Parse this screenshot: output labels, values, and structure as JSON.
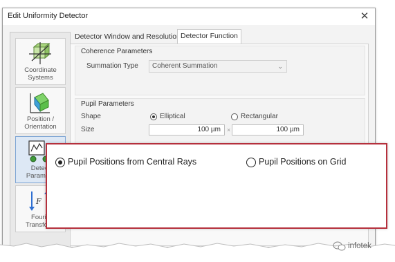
{
  "window": {
    "title": "Edit Uniformity Detector",
    "close_glyph": "✕"
  },
  "sidebar": {
    "items": [
      {
        "label": "Coordinate Systems",
        "icon": "coordinate-axes-icon",
        "active": false
      },
      {
        "label": "Position / Orientation",
        "icon": "position-orientation-icon",
        "active": false
      },
      {
        "label": "Detector Parameters",
        "visible_label": "Detect Paramete",
        "icon": "detector-parameters-icon",
        "active": true
      },
      {
        "label": "Fourier Transforms",
        "visible_label": "Fourie Transform",
        "icon": "fourier-transform-icon",
        "active": false
      }
    ]
  },
  "tabs": [
    {
      "label": "Detector Window and Resolution",
      "active": false
    },
    {
      "label": "Detector Function",
      "active": true
    }
  ],
  "coherence": {
    "title": "Coherence Parameters",
    "summation_label": "Summation Type",
    "summation_value": "Coherent Summation"
  },
  "pupil": {
    "title": "Pupil Parameters",
    "shape_label": "Shape",
    "shape_options": [
      {
        "label": "Elliptical",
        "selected": true
      },
      {
        "label": "Rectangular",
        "selected": false
      }
    ],
    "size_label": "Size",
    "size_x": "100 µm",
    "size_y": "100 µm",
    "times": "×"
  },
  "overlay": {
    "options": [
      {
        "label": "Pupil Positions from Central Rays",
        "selected": true
      },
      {
        "label": "Pupil Positions on Grid",
        "selected": false
      }
    ]
  },
  "watermark": {
    "text": "infotek"
  },
  "colors": {
    "highlight_border": "#b5303c",
    "active_side_item": "#dde8f5"
  }
}
